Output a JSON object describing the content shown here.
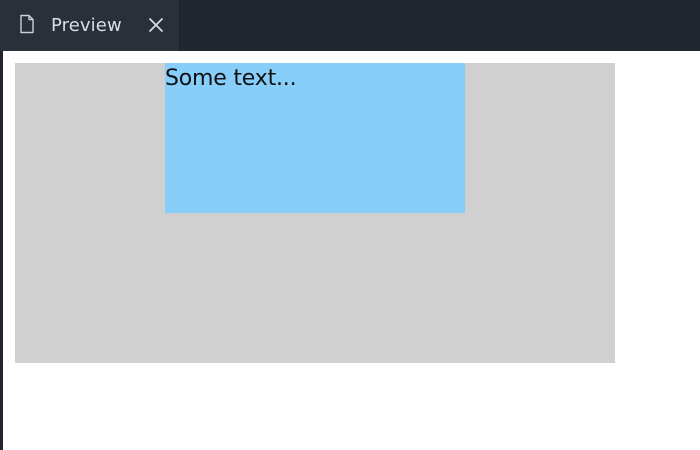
{
  "tab": {
    "label": "Preview",
    "icon": "file-icon",
    "close_icon": "close-icon"
  },
  "content": {
    "text": "Some text..."
  },
  "colors": {
    "tabbar_background": "#20252f",
    "active_tab_background": "#2a2f3a",
    "outer_box": "#d0d0d0",
    "inner_box": "#87cefa",
    "page_background": "#ffffff"
  }
}
